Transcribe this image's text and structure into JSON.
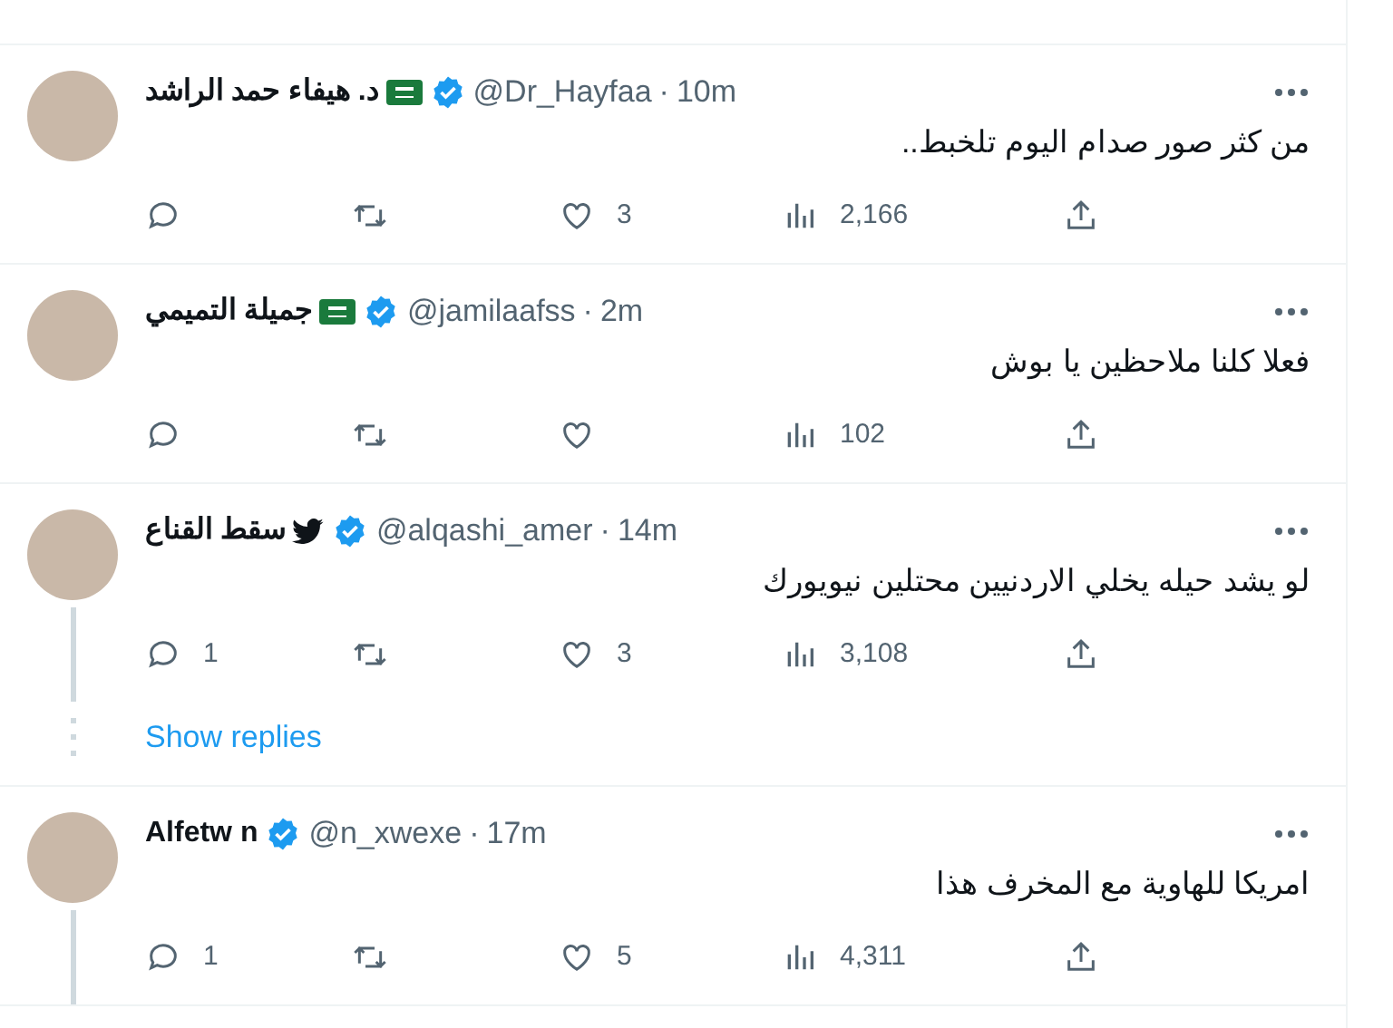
{
  "tweets": [
    {
      "name": "د. هيفاء حمد الراشد",
      "flag": true,
      "bird": false,
      "verified": true,
      "handle": "@Dr_Hayfaa",
      "separator": "·",
      "time": "10m",
      "text": "من كثر صور صدام اليوم تلخبط..",
      "likes": "3",
      "views": "2,166",
      "thread_line": false
    },
    {
      "name": "جميلة التميمي",
      "flag": true,
      "bird": false,
      "verified": true,
      "handle": "@jamilaafss",
      "separator": "·",
      "time": "2m",
      "text": "فعلا كلنا ملاحظين يا بوش",
      "views": "102",
      "thread_line": false
    },
    {
      "name": "سقط القناع",
      "flag": false,
      "bird": true,
      "verified": true,
      "handle": "@alqashi_amer",
      "separator": "·",
      "time": "14m",
      "text": "لو يشد حيله يخلي الاردنيين محتلين نيويورك",
      "replies": "1",
      "likes": "3",
      "views": "3,108",
      "thread_line": true,
      "show_replies": "Show replies"
    },
    {
      "name": "Alfetw n",
      "flag": false,
      "bird": false,
      "verified": true,
      "handle": "@n_xwexe",
      "separator": "·",
      "time": "17m",
      "text": "امريكا للهاوية مع المخرف هذا",
      "replies": "1",
      "likes": "5",
      "views": "4,311",
      "thread_line": true
    }
  ]
}
